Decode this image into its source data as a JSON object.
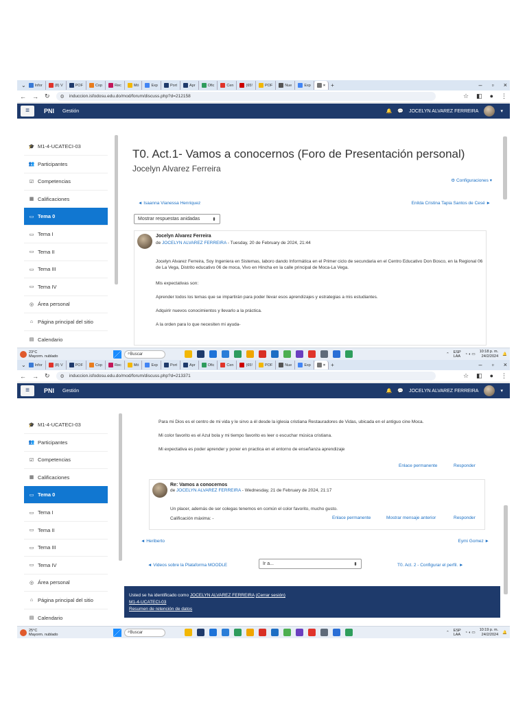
{
  "browser": {
    "tabs": [
      "Infor",
      "(8) V",
      "POF",
      "Cop",
      "Rec",
      "Mó",
      "Exp",
      "Port",
      "Apr",
      "Ofic",
      "Cen",
      "(65!",
      "POF",
      "Nue",
      "Exp"
    ],
    "active_tab_close": "×",
    "new_tab": "+",
    "win_min": "–",
    "win_max": "▫",
    "win_close": "×"
  },
  "shot1": {
    "url": "induccion.isfodosu.edu.do/mod/forum/discuss.php?d=212158",
    "navbar": {
      "brand": "PNI",
      "gestion": "Gestión",
      "user": "JOCELYN ALVAREZ FERREIRA"
    },
    "drawer": [
      {
        "label": "M1-4-UCATECI-03",
        "icon": "graduation-cap-icon",
        "glyph": "🎓",
        "active": false
      },
      {
        "label": "Participantes",
        "icon": "users-icon",
        "glyph": "👥",
        "active": false
      },
      {
        "label": "Competencias",
        "icon": "checkbox-icon",
        "glyph": "☑",
        "active": false
      },
      {
        "label": "Calificaciones",
        "icon": "table-icon",
        "glyph": "▦",
        "active": false
      },
      {
        "label": "Tema 0",
        "icon": "folder-icon",
        "glyph": "▭",
        "active": true
      },
      {
        "label": "Tema I",
        "icon": "folder-icon",
        "glyph": "▭",
        "active": false
      },
      {
        "label": "Tema II",
        "icon": "folder-icon",
        "glyph": "▭",
        "active": false
      },
      {
        "label": "Tema III",
        "icon": "folder-icon",
        "glyph": "▭",
        "active": false
      },
      {
        "label": "Tema IV",
        "icon": "folder-icon",
        "glyph": "▭",
        "active": false
      },
      {
        "label": "Área personal",
        "icon": "dashboard-icon",
        "glyph": "◎",
        "active": false
      },
      {
        "label": "Página principal del sitio",
        "icon": "home-icon",
        "glyph": "⌂",
        "active": false
      },
      {
        "label": "Calendario",
        "icon": "calendar-icon",
        "glyph": "▤",
        "active": false
      }
    ],
    "title": "T0. Act.1- Vamos a conocernos (Foro de Presentación personal)",
    "subtitle": "Jocelyn Alvarez Ferreira",
    "settings_label": "Configuraciones",
    "prev_link": "◄ Isaanna Vianessa Henriquez",
    "next_link": "Enilda Cristina Tapia Santos de Cesé ►",
    "display_mode": "Mostrar respuestas anidadas",
    "post": {
      "subject": "Jocelyn Alvarez Ferreira",
      "by_prefix": "de",
      "author": "JOCELYN ALVAREZ FERREIRA",
      "date": " - Tuesday, 20 de February de 2024, 21:44",
      "paragraphs": [
        "Jocelyn Alvarez Ferreira, Soy Ingeniera en Sistemas, laboro dando Informática en el Primer ciclo de secundaria en el Centro Educativo Don Bosco, en la Regional 06 de La Vega, Distrito educativo 06 de moca, Vivo en Hincha en la calle principal de Moca-La Vega.",
        "Mis expectativas son:",
        "Aprender todos los temas que se impartirán para poder llevar esos aprendizajes y estrategias a mis estudiantes.",
        "Adquirir nuevos conocimientos y llevarlo a la práctica.",
        "A la orden para lo que necesiten mi ayuda-"
      ]
    }
  },
  "shot2": {
    "url": "induccion.isfodosu.edu.do/mod/forum/discuss.php?d=213371",
    "navbar": {
      "brand": "PNI",
      "gestion": "Gestión",
      "user": "JOCELYN ALVAREZ FERREIRA"
    },
    "post_top": [
      "Para mi Dios es el centro de mi vida y le sirvo a él desde la iglesia cristiana Restauradores de Vidas, ubicada en el antiguo cine Moca.",
      "Mi color favorito es el Azul bola y mi tiempo favorito es leer o escuchar música cristiana.",
      "Mi expectativa es poder aprender y poner en practica en el entorno de enseñanza aprendizaje"
    ],
    "permalink": "Enlace permanente",
    "reply": "Responder",
    "reply_post": {
      "subject": "Re: Vamos a conocernos",
      "by_prefix": "de",
      "author": "JOCELYN ALVAREZ FERREIRA",
      "date": " - Wednesday, 21 de February de 2024, 21:17",
      "body": "Un placer, además de ser colegas tenemos en común el color favorito, mucho gusto.",
      "grade": "Calificación máxima: -",
      "permalink": "Enlace permanente",
      "prev_message": "Mostrar mensaje anterior",
      "reply": "Responder"
    },
    "prev_link": "◄ Heriberto",
    "next_link": "Eymi Gomez ►",
    "prev_activity": "◄ Videos sobre la Plataforma MOODLE",
    "jump_to": "Ir a...",
    "next_activity": "T0. Act. 2 - Configurar el perfil. ►",
    "footer": {
      "logged_prefix": "Usted se ha identificado como",
      "logged_user": "JOCELYN ALVAREZ FERREIRA",
      "logout": "(Cerrar sesión)",
      "course": "M1-4-UCATECI-03",
      "retention": "Resumen de retención de datos"
    }
  },
  "taskbar": {
    "temp": "23°C",
    "weather": "Mayorm. nublado",
    "search": "Buscar",
    "lang": "ESP",
    "lang2": "LAA",
    "time": "10:18 p. m.",
    "date": "24/2/2024"
  },
  "taskbar2": {
    "temp": "25°C",
    "weather": "Mayorm. nublado",
    "search": "Buscar",
    "lang": "ESP",
    "lang2": "LAA",
    "time": "10:19 p. m.",
    "date": "24/2/2024"
  },
  "colors": {
    "navbar": "#1e3a6b",
    "active_drawer": "#1177d1",
    "link": "#1a6fc4"
  }
}
